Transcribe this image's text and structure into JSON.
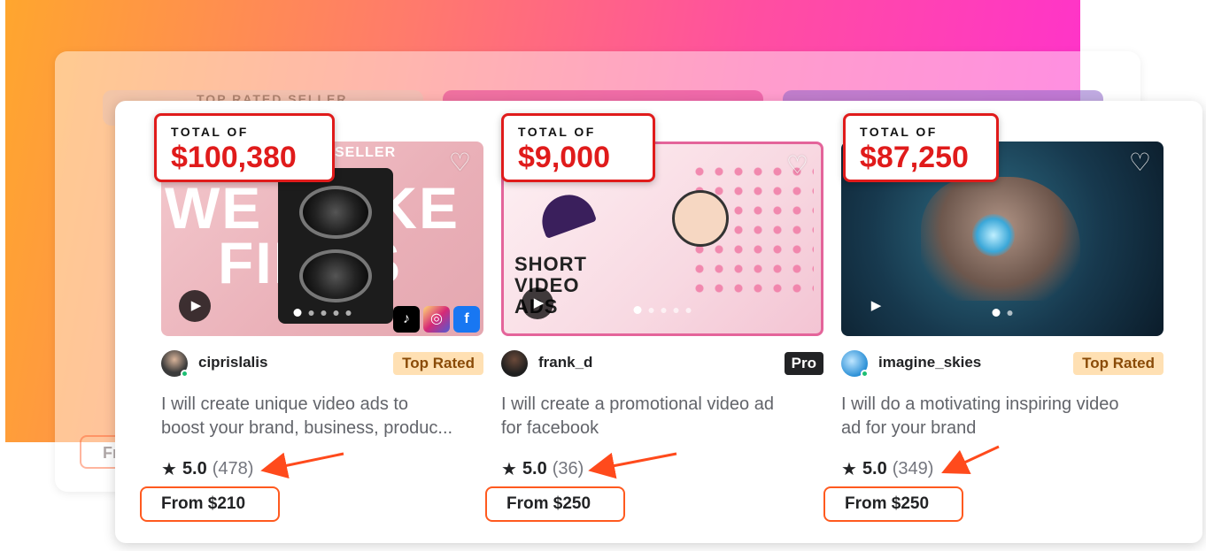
{
  "background": {
    "gradient_colors": [
      "#ffa62e",
      "#ff4fa0",
      "#ff2fd0"
    ],
    "ghost_ribbon": "TOP RATED SELLER",
    "ghost_from": "Fr"
  },
  "cards": [
    {
      "seller": "ciprislalis",
      "badge": "Top Rated",
      "badge_type": "top-rated",
      "title_line1": "I will create unique video ads to",
      "title_line2": "boost your brand, business, produc...",
      "rating": "5.0",
      "reviews": "(478)",
      "price": "From $210",
      "total_label": "TOTAL OF",
      "total_value": "$100,380",
      "thumb": {
        "ribbon": "SELLER",
        "headline1": "WE MAKE",
        "headline2": "FILMS",
        "social": [
          "tiktok-icon",
          "instagram-icon",
          "facebook-icon"
        ],
        "slides": 5,
        "active_slide": 0
      }
    },
    {
      "seller": "frank_d",
      "badge": "Pro",
      "badge_type": "pro",
      "title_line1": "I will create a promotional video ad",
      "title_line2": "for facebook",
      "rating": "5.0",
      "reviews": "(36)",
      "price": "From $250",
      "total_label": "TOTAL OF",
      "total_value": "$9,000",
      "thumb": {
        "headline1": "SHORT",
        "headline2": "VIDEO",
        "headline3": "ADS",
        "slides": 5,
        "active_slide": 0
      }
    },
    {
      "seller": "imagine_skies",
      "badge": "Top Rated",
      "badge_type": "top-rated",
      "title_line1": "I will do a motivating inspiring video",
      "title_line2": "ad for your brand",
      "rating": "5.0",
      "reviews": "(349)",
      "price": "From $250",
      "total_label": "TOTAL OF",
      "total_value": "$87,250",
      "thumb": {
        "slides": 2,
        "active_slide": 0
      }
    }
  ],
  "colors": {
    "callout_red": "#e01b1b",
    "arrow_orange": "#ff4a1c",
    "top_rated_bg": "#ffe0b3",
    "online_green": "#1dbf73"
  }
}
